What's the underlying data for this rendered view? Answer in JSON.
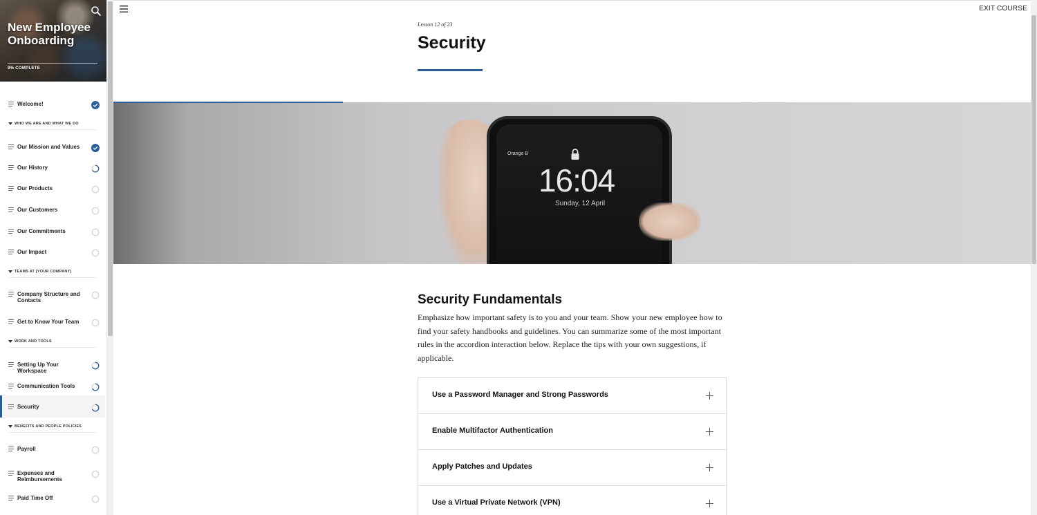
{
  "sidebar": {
    "course_title": "New Employee Onboarding",
    "progress_text": "9% COMPLETE",
    "items": [
      {
        "type": "lesson",
        "label": "Welcome!",
        "status": "complete"
      },
      {
        "type": "section",
        "label": "WHO WE ARE AND WHAT WE DO"
      },
      {
        "type": "lesson",
        "label": "Our Mission and Values",
        "status": "complete"
      },
      {
        "type": "lesson",
        "label": "Our History",
        "status": "in-progress"
      },
      {
        "type": "lesson",
        "label": "Our Products",
        "status": "not-started"
      },
      {
        "type": "lesson",
        "label": "Our Customers",
        "status": "not-started"
      },
      {
        "type": "lesson",
        "label": "Our Commitments",
        "status": "not-started"
      },
      {
        "type": "lesson",
        "label": "Our Impact",
        "status": "not-started"
      },
      {
        "type": "section",
        "label": "TEAMS AT [YOUR COMPANY]"
      },
      {
        "type": "lesson",
        "label": "Company Structure and Contacts",
        "status": "not-started"
      },
      {
        "type": "lesson",
        "label": "Get to Know Your Team",
        "status": "not-started"
      },
      {
        "type": "section",
        "label": "WORK AND TOOLS"
      },
      {
        "type": "lesson",
        "label": "Setting Up Your Workspace",
        "status": "in-progress"
      },
      {
        "type": "lesson",
        "label": "Communication Tools",
        "status": "in-progress"
      },
      {
        "type": "lesson",
        "label": "Security",
        "status": "in-progress",
        "active": true
      },
      {
        "type": "section",
        "label": "BENEFITS AND PEOPLE POLICIES"
      },
      {
        "type": "lesson",
        "label": "Payroll",
        "status": "not-started"
      },
      {
        "type": "lesson",
        "label": "Expenses and Reimbursements",
        "status": "not-started"
      },
      {
        "type": "lesson",
        "label": "Paid Time Off",
        "status": "not-started"
      }
    ]
  },
  "header": {
    "exit_label": "EXIT COURSE",
    "lesson_count": "Lesson 12 of 23",
    "lesson_title": "Security"
  },
  "hero": {
    "carrier": "Orange B",
    "clock": "16:04",
    "date": "Sunday, 12 April"
  },
  "content": {
    "title": "Security Fundamentals",
    "body": "Emphasize how important safety is to you and your team. Show your new employee how to find your safety handbooks and guidelines. You can summarize some of the most important rules in the accordion interaction below. Replace the tips with your own suggestions, if applicable.",
    "accordion": [
      "Use a Password Manager and Strong Passwords",
      "Enable Multifactor Authentication",
      "Apply Patches and Updates",
      "Use a Virtual Private Network (VPN)"
    ]
  },
  "colors": {
    "accent": "#2d5f9a"
  }
}
